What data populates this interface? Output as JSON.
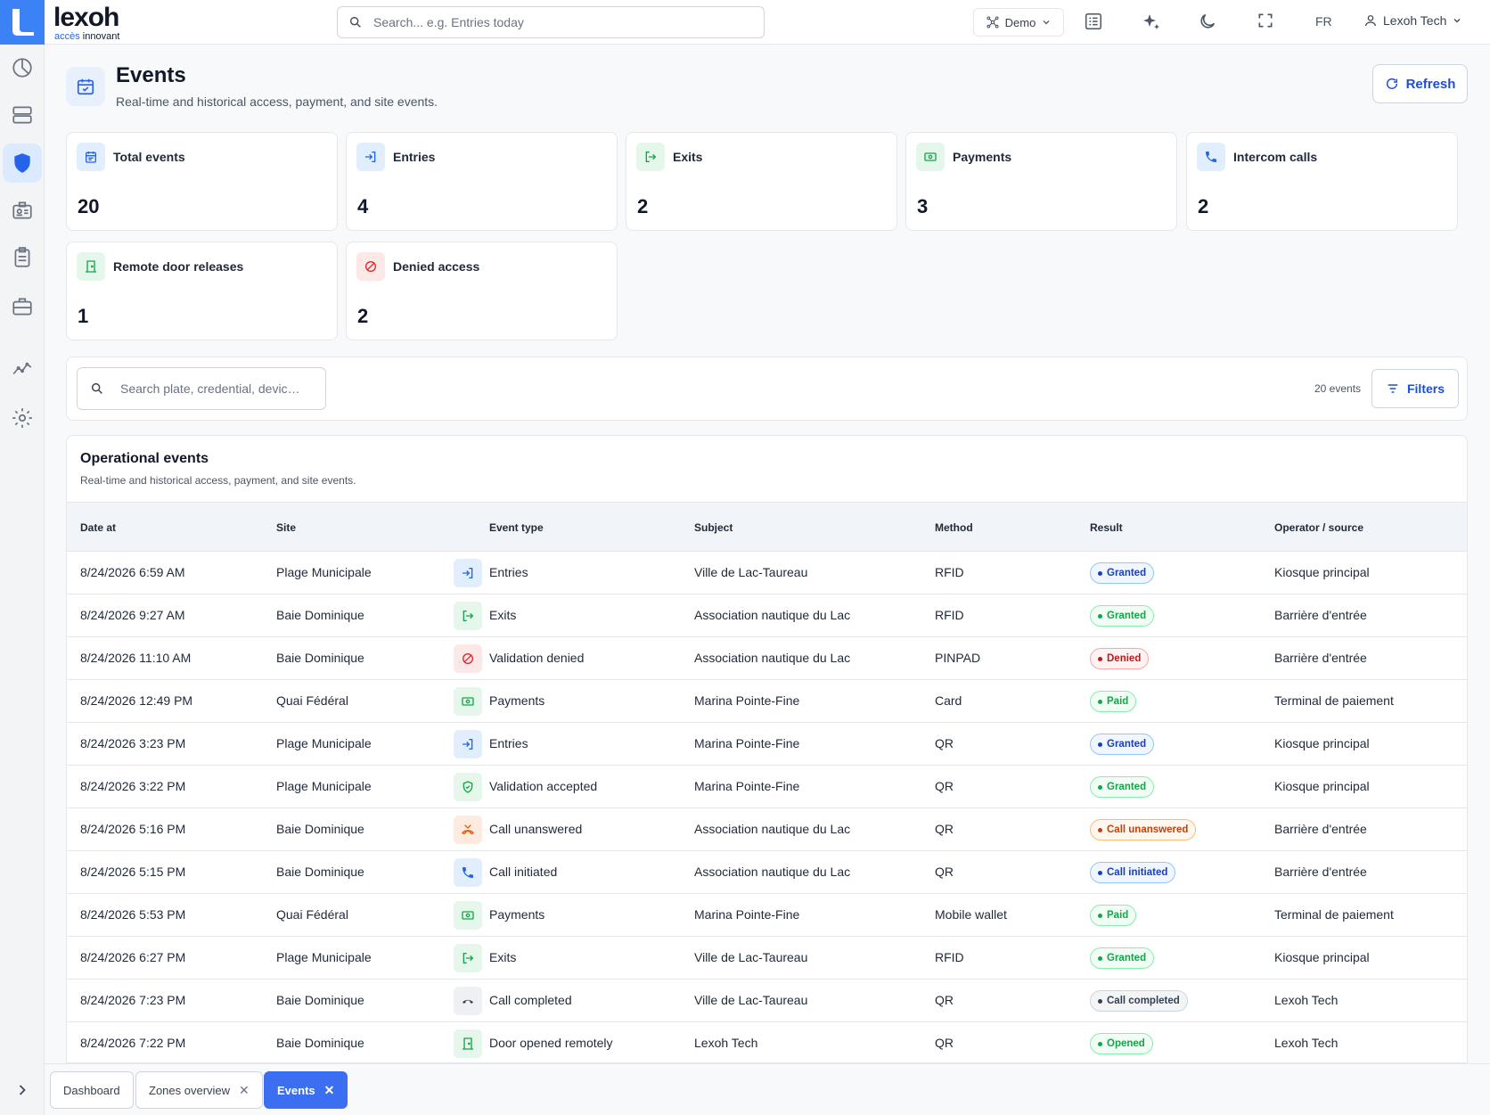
{
  "brand": {
    "name": "lexoh",
    "tag_accent": "accès",
    "tag_rest": " innovant"
  },
  "topbar": {
    "search_placeholder": "Search... e.g. Entries today",
    "demo_label": "Demo",
    "lang": "FR",
    "user": "Lexoh Tech"
  },
  "page": {
    "title": "Events",
    "subtitle": "Real-time and historical access, payment, and site events.",
    "refresh_label": "Refresh"
  },
  "stats": [
    {
      "label": "Total events",
      "value": "20",
      "icon": "calendar-icon",
      "tone": "blue"
    },
    {
      "label": "Entries",
      "value": "4",
      "icon": "login-icon",
      "tone": "blue"
    },
    {
      "label": "Exits",
      "value": "2",
      "icon": "logout-icon",
      "tone": "green"
    },
    {
      "label": "Payments",
      "value": "3",
      "icon": "cash-icon",
      "tone": "green"
    },
    {
      "label": "Intercom calls",
      "value": "2",
      "icon": "phone-icon",
      "tone": "blue"
    },
    {
      "label": "Remote door releases",
      "value": "1",
      "icon": "door-icon",
      "tone": "green"
    },
    {
      "label": "Denied access",
      "value": "2",
      "icon": "ban-icon",
      "tone": "red"
    }
  ],
  "filters": {
    "search_placeholder": "Search plate, credential, devic…",
    "count_label": "20 events",
    "filters_label": "Filters"
  },
  "table": {
    "title": "Operational events",
    "subtitle": "Real-time and historical access, payment, and site events.",
    "columns": [
      "Date at",
      "Site",
      "Event type",
      "Subject",
      "Method",
      "Result",
      "Operator / source"
    ],
    "rows": [
      {
        "date": "8/24/2026 6:59 AM",
        "site": "Plage Municipale",
        "type": "Entries",
        "icon": "login-icon",
        "tone": "blue",
        "subject": "Ville de Lac-Taureau",
        "method": "RFID",
        "result": "Granted",
        "rtone": "blue",
        "op": "Kiosque principal"
      },
      {
        "date": "8/24/2026 9:27 AM",
        "site": "Baie Dominique",
        "type": "Exits",
        "icon": "logout-icon",
        "tone": "green",
        "subject": "Association nautique du Lac",
        "method": "RFID",
        "result": "Granted",
        "rtone": "green",
        "op": "Barrière d'entrée"
      },
      {
        "date": "8/24/2026 11:10 AM",
        "site": "Baie Dominique",
        "type": "Validation denied",
        "icon": "ban-icon",
        "tone": "red",
        "subject": "Association nautique du Lac",
        "method": "PINPAD",
        "result": "Denied",
        "rtone": "red",
        "op": "Barrière d'entrée"
      },
      {
        "date": "8/24/2026 12:49 PM",
        "site": "Quai Fédéral",
        "type": "Payments",
        "icon": "cash-icon",
        "tone": "green",
        "subject": "Marina Pointe-Fine",
        "method": "Card",
        "result": "Paid",
        "rtone": "green",
        "op": "Terminal de paiement"
      },
      {
        "date": "8/24/2026 3:23 PM",
        "site": "Plage Municipale",
        "type": "Entries",
        "icon": "login-icon",
        "tone": "blue",
        "subject": "Marina Pointe-Fine",
        "method": "QR",
        "result": "Granted",
        "rtone": "blue",
        "op": "Kiosque principal"
      },
      {
        "date": "8/24/2026 3:22 PM",
        "site": "Plage Municipale",
        "type": "Validation accepted",
        "icon": "shield-check-icon",
        "tone": "green",
        "subject": "Marina Pointe-Fine",
        "method": "QR",
        "result": "Granted",
        "rtone": "green",
        "op": "Kiosque principal"
      },
      {
        "date": "8/24/2026 5:16 PM",
        "site": "Baie Dominique",
        "type": "Call unanswered",
        "icon": "phone-missed-icon",
        "tone": "orange",
        "subject": "Association nautique du Lac",
        "method": "QR",
        "result": "Call unanswered",
        "rtone": "orange",
        "op": "Barrière d'entrée"
      },
      {
        "date": "8/24/2026 5:15 PM",
        "site": "Baie Dominique",
        "type": "Call initiated",
        "icon": "phone-icon",
        "tone": "blue",
        "subject": "Association nautique du Lac",
        "method": "QR",
        "result": "Call initiated",
        "rtone": "blue",
        "op": "Barrière d'entrée"
      },
      {
        "date": "8/24/2026 5:53 PM",
        "site": "Quai Fédéral",
        "type": "Payments",
        "icon": "cash-icon",
        "tone": "green",
        "subject": "Marina Pointe-Fine",
        "method": "Mobile wallet",
        "result": "Paid",
        "rtone": "green",
        "op": "Terminal de paiement"
      },
      {
        "date": "8/24/2026 6:27 PM",
        "site": "Plage Municipale",
        "type": "Exits",
        "icon": "logout-icon",
        "tone": "green",
        "subject": "Ville de Lac-Taureau",
        "method": "RFID",
        "result": "Granted",
        "rtone": "green",
        "op": "Kiosque principal"
      },
      {
        "date": "8/24/2026 7:23 PM",
        "site": "Baie Dominique",
        "type": "Call completed",
        "icon": "phone-end-icon",
        "tone": "gray",
        "subject": "Ville de Lac-Taureau",
        "method": "QR",
        "result": "Call completed",
        "rtone": "gray",
        "op": "Lexoh Tech"
      },
      {
        "date": "8/24/2026 7:22 PM",
        "site": "Baie Dominique",
        "type": "Door opened remotely",
        "icon": "door-icon",
        "tone": "green",
        "subject": "Lexoh Tech",
        "method": "QR",
        "result": "Opened",
        "rtone": "green",
        "op": "Lexoh Tech"
      }
    ]
  },
  "bottom_tabs": [
    {
      "label": "Dashboard",
      "closable": false,
      "active": false
    },
    {
      "label": "Zones overview",
      "closable": true,
      "active": false
    },
    {
      "label": "Events",
      "closable": true,
      "active": true
    }
  ],
  "colors": {
    "accent": "#2563eb",
    "active_tab": "#3b6ef0"
  }
}
